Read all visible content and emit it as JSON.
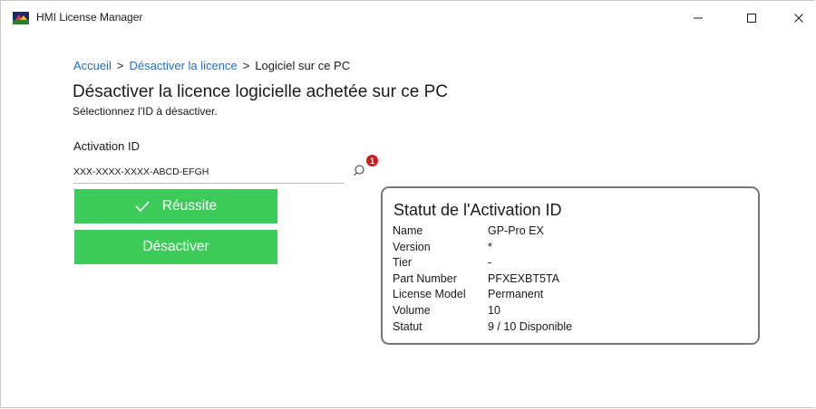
{
  "window": {
    "title": "HMI License Manager",
    "controls": {
      "minimize": "—",
      "maximize": "☐",
      "close": "✕"
    }
  },
  "breadcrumb": {
    "home": "Accueil",
    "separator": ">",
    "parent": "Désactiver la licence",
    "current": "Logiciel sur ce PC"
  },
  "page": {
    "title": "Désactiver la licence logicielle achetée sur ce PC",
    "subtitle": "Sélectionnez l'ID à désactiver."
  },
  "activation_field": {
    "label": "Activation ID",
    "value": "XXX-XXXX-XXXX-ABCD-EFGH",
    "search_icon": "search-icon",
    "notification_count": "1"
  },
  "buttons": {
    "success_label": "Réussite",
    "success_icon": "checkmark-icon",
    "deactivate_label": "Désactiver"
  },
  "status_card": {
    "title": "Statut de l'Activation ID",
    "rows": [
      {
        "key": "Name",
        "value": "GP-Pro EX"
      },
      {
        "key": "Version",
        "value": "*"
      },
      {
        "key": "Tier",
        "value": "-"
      },
      {
        "key": "Part Number",
        "value": "PFXEXBT5TA"
      },
      {
        "key": "License Model",
        "value": "Permanent"
      },
      {
        "key": "Volume",
        "value": "10"
      },
      {
        "key": "Statut",
        "value": "9 / 10 Disponible"
      }
    ]
  },
  "colors": {
    "accent_green": "#3dcc5a",
    "link_blue": "#1f6fc4",
    "badge_red": "#d21c1c",
    "card_border": "#767676"
  }
}
